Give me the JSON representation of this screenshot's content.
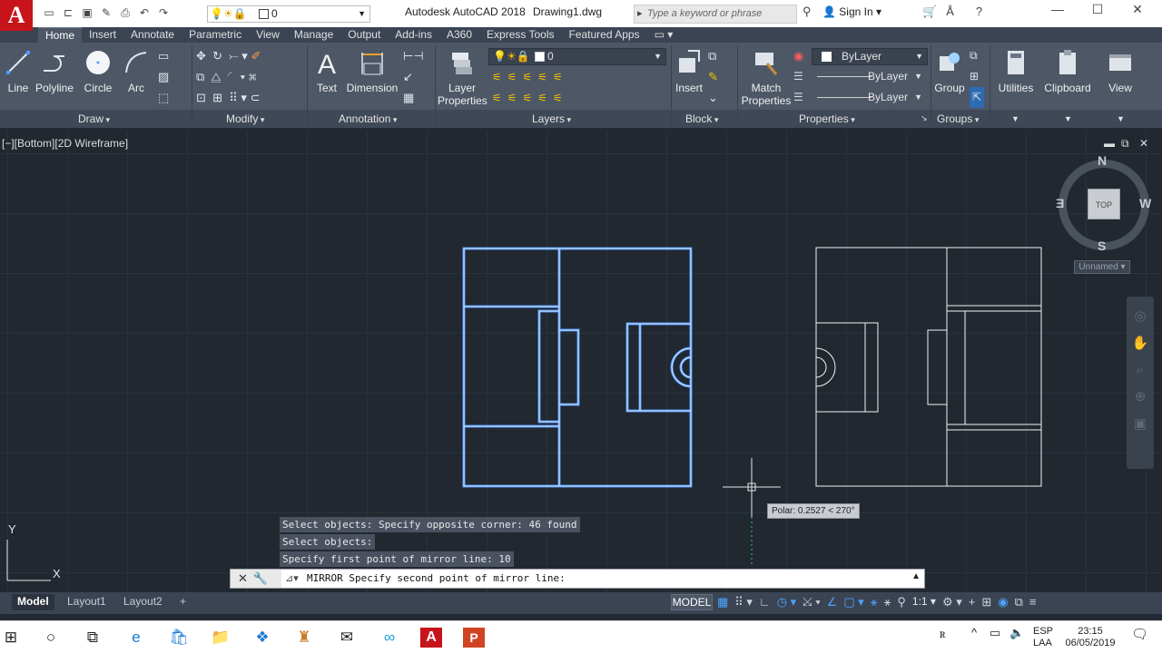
{
  "titlebar": {
    "app_logo": "A",
    "app_name": "Autodesk AutoCAD 2018",
    "file_name": "Drawing1.dwg",
    "layer_value": "0",
    "search_placeholder": "Type a keyword or phrase",
    "sign_in": "Sign In"
  },
  "ribbon_tabs": [
    "Home",
    "Insert",
    "Annotate",
    "Parametric",
    "View",
    "Manage",
    "Output",
    "Add-ins",
    "A360",
    "Express Tools",
    "Featured Apps"
  ],
  "active_tab": "Home",
  "draw_panel": {
    "line": "Line",
    "polyline": "Polyline",
    "circle": "Circle",
    "arc": "Arc",
    "label": "Draw"
  },
  "modify_panel": {
    "label": "Modify"
  },
  "annotation_panel": {
    "text": "Text",
    "dimension": "Dimension",
    "label": "Annotation"
  },
  "layers_panel": {
    "layer_properties_1": "Layer",
    "layer_properties_2": "Properties",
    "layer_value": "0",
    "label": "Layers"
  },
  "block_panel": {
    "insert": "Insert",
    "label": "Block"
  },
  "properties_panel": {
    "match_1": "Match",
    "match_2": "Properties",
    "color": "ByLayer",
    "linetype": "ByLayer",
    "lineweight": "ByLayer",
    "label": "Properties"
  },
  "groups_panel": {
    "group": "Group",
    "label": "Groups"
  },
  "utilities": "Utilities",
  "clipboard": "Clipboard",
  "view": "View",
  "viewport": {
    "label": "[−][Bottom][2D Wireframe]"
  },
  "viewcube": {
    "north": "N",
    "south": "S",
    "east": "E",
    "west": "W",
    "face": "TOP",
    "ucs": "Unnamed"
  },
  "ucs_icon": {
    "x": "X",
    "y": "Y"
  },
  "polar_tooltip": "Polar: 0.2527 < 270°",
  "command_history": [
    "Select objects: Specify opposite corner: 46 found",
    "Select objects:",
    "Specify first point of mirror line: 10"
  ],
  "command_prompt": "MIRROR Specify second point of mirror line:",
  "layout_tabs": [
    "Model",
    "Layout1",
    "Layout2"
  ],
  "status": {
    "model": "MODEL",
    "scale": "1:1"
  },
  "taskbar": {
    "lang1": "ESP",
    "lang2": "LAA",
    "time": "23:15",
    "date": "06/05/2019"
  },
  "colors": {
    "selected_blue": "#4f9bff",
    "canvas_bg": "#212830",
    "ribbon_bg": "#4d5766",
    "logo_red": "#c7141a"
  }
}
